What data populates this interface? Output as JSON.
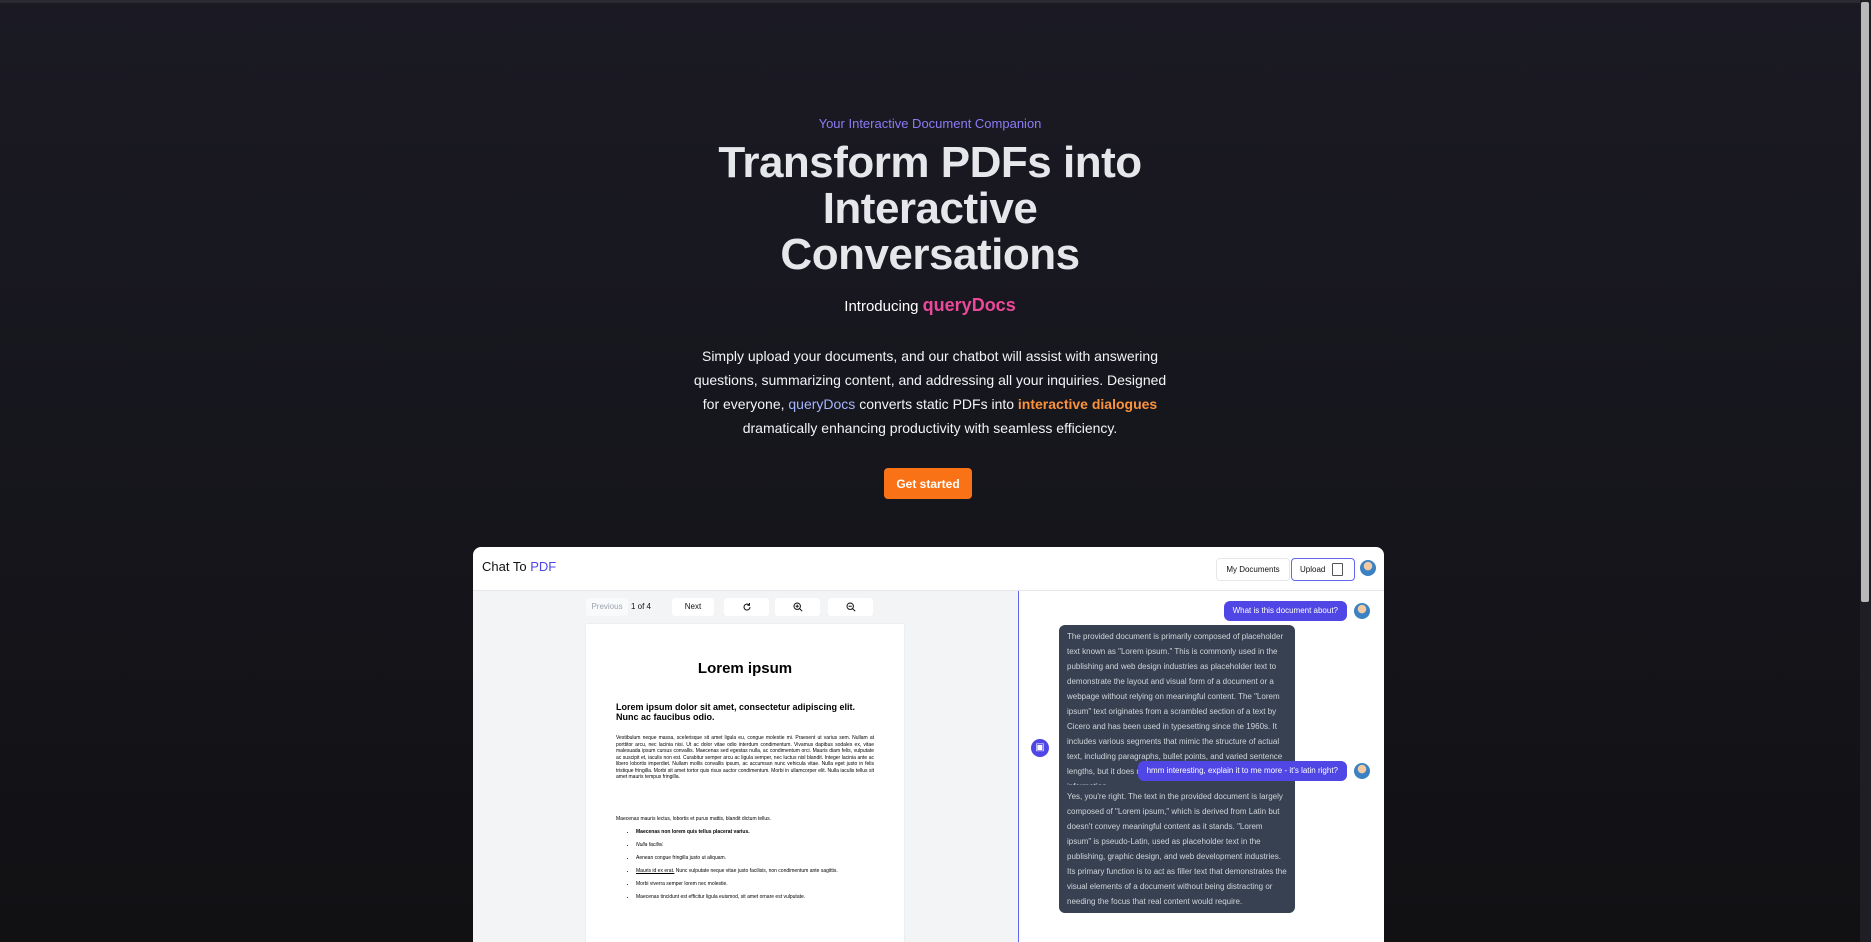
{
  "hero": {
    "eyebrow": "Your Interactive Document Companion",
    "headline_line1": "Transform PDFs into",
    "headline_line2": "Interactive",
    "headline_line3": "Conversations",
    "intro_prefix": "Introducing",
    "brand": "queryDocs",
    "desc_part1": "Simply upload your documents, and our chatbot will assist with answering questions, summarizing content, and addressing all your inquiries. Designed for everyone,",
    "desc_brand": "queryDocs",
    "desc_part2": "converts static PDFs into",
    "desc_highlight": "interactive dialogues",
    "desc_part3": "dramatically enhancing productivity with seamless efficiency.",
    "cta_label": "Get started"
  },
  "app": {
    "logo_prefix": "Chat To",
    "logo_accent": "PDF",
    "my_documents_label": "My Documents",
    "upload_label": "Upload",
    "viewer": {
      "previous_label": "Previous",
      "page_indicator": "1 of 4",
      "next_label": "Next",
      "rotate_icon": "rotate-icon",
      "zoom_in_icon": "zoom-in-icon",
      "zoom_out_icon": "zoom-out-icon"
    },
    "document": {
      "title": "Lorem ipsum",
      "subtitle": "Lorem ipsum dolor sit amet, consectetur adipiscing elit. Nunc ac faucibus odio.",
      "paragraph": "Vestibulum neque massa, scelerisque sit amet ligula eu, congue molestie mi. Praesent ut varius sem. Nullam at porttitor arcu, nec lacinia nisi. Ut ac dolor vitae odio interdum condimentum. Vivamus dapibus sodales ex, vitae malesuada ipsum cursus convallis. Maecenas sed egestas nulla, ac condimentum orci. Mauris diam felis, vulputate ac suscipit et, iaculis non est. Curabitur semper arcu ac ligula semper, nec luctus nisl blandit. Integer lacinia ante ac libero lobortis imperdiet. Nullam mollis convallis ipsum, ac accumsan nunc vehicula vitae. Nulla eget justo in felis tristique fringilla. Morbi sit amet tortor quis risus auctor condimentum. Morbi in ullamcorper elit. Nulla iaculis tellus sit amet mauris tempus fringilla.",
      "paragraph2": "Maecenas mauris lectus, lobortis et purus mattis, blandit dictum tellus.",
      "list_1": "Maecenas non lorem quis tellus placerat varius.",
      "list_2": "Nulla facilisi.",
      "list_3": "Aenean congue fringilla justo ut aliquam.",
      "list_4_link": "Mauris id ex erat.",
      "list_4_rest": "Nunc vulputate neque vitae justo facilisis, non condimentum ante sagittis.",
      "list_5": "Morbi viverra semper lorem nec molestie.",
      "list_6": "Maecenas tincidunt est efficitur ligula euismod, sit amet ornare est vulputate."
    },
    "chat": {
      "user_msg_1": "What is this document about?",
      "bot_msg_1": "The provided document is primarily composed of placeholder text known as \"Lorem ipsum.\" This is commonly used in the publishing and web design industries as placeholder text to demonstrate the layout and visual form of a document or a webpage without relying on meaningful content. The \"Lorem ipsum\" text originates from a scrambled section of a text by Cicero and has been used in typesetting since the 1960s. It includes various segments that mimic the structure of actual text, including paragraphs, bullet points, and varied sentence lengths, but it does not convey any specific or coherent information.",
      "user_msg_2": "hmm interesting, explain it to me more - it's latin right?",
      "bot_msg_2": "Yes, you're right. The text in the provided document is largely composed of \"Lorem ipsum,\" which is derived from Latin but doesn't convey meaningful content as it stands. \"Lorem ipsum\" is pseudo-Latin, used as placeholder text in the publishing, graphic design, and web development industries. Its primary function is to act as filler text that demonstrates the visual elements of a document without being distracting or needing the focus that real content would require.",
      "bot_icon": "robot-icon"
    }
  },
  "colors": {
    "accent_purple": "#8b7cf6",
    "brand_pink": "#ec4899",
    "cta_orange": "#f97316",
    "chat_user": "#4f46e5",
    "chat_bot": "#374151"
  }
}
